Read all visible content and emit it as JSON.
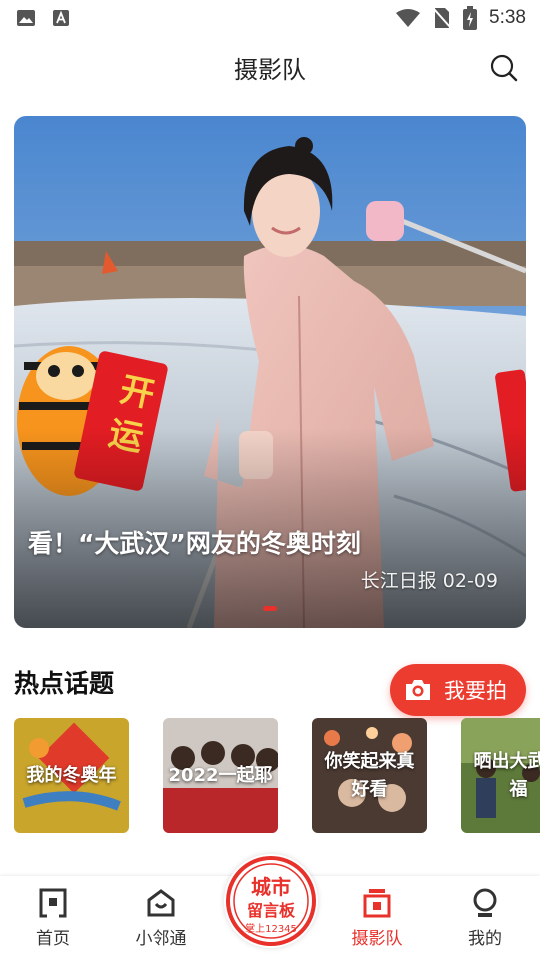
{
  "status_bar": {
    "time": "5:38"
  },
  "header": {
    "title": "摄影队"
  },
  "banner": {
    "title": "看！“大武汉”网友的冬奥时刻",
    "source": "长江日报",
    "date": "02-09",
    "sign_text_1": "开",
    "sign_text_2": "运"
  },
  "hot_topics": {
    "section_title": "热点话题",
    "action_label": "我要拍",
    "items": [
      {
        "label": "我的冬奥年"
      },
      {
        "label": "2022一起耶"
      },
      {
        "label": "你笑起来真好看"
      },
      {
        "label": "晒出大武幸福"
      }
    ]
  },
  "bottom_nav": {
    "items": [
      {
        "label": "首页"
      },
      {
        "label": "小邻通"
      },
      {
        "label": "摄影队"
      },
      {
        "label": "我的"
      }
    ],
    "center_badge": {
      "line1": "城市",
      "line2": "留言板",
      "line3": "掌上12345"
    }
  },
  "colors": {
    "accent": "#e8312a",
    "fab": "#ec3b2f"
  }
}
